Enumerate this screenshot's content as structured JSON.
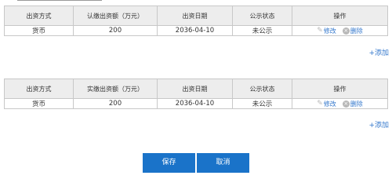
{
  "tables": [
    {
      "headers": [
        "出资方式",
        "认缴出资额（万元）",
        "出资日期",
        "公示状态",
        "操作"
      ],
      "row": {
        "method": "货币",
        "amount": "200",
        "date": "2036-04-10",
        "status": "未公示"
      },
      "edit_label": "修改",
      "delete_label": "删除",
      "add_label": "+添加"
    },
    {
      "headers": [
        "出资方式",
        "实缴出资额（万元）",
        "出资日期",
        "公示状态",
        "操作"
      ],
      "row": {
        "method": "货币",
        "amount": "200",
        "date": "2036-04-10",
        "status": "未公示"
      },
      "edit_label": "修改",
      "delete_label": "删除",
      "add_label": "+添加"
    }
  ],
  "buttons": {
    "save_label": "保存",
    "cancel_label": "取消"
  },
  "colors": {
    "primary": "#1a73c9",
    "link": "#3377cc",
    "header_bg": "#ededed",
    "border": "#c8c8c8"
  },
  "icons": [
    "pencil-icon",
    "delete-circle-icon"
  ]
}
